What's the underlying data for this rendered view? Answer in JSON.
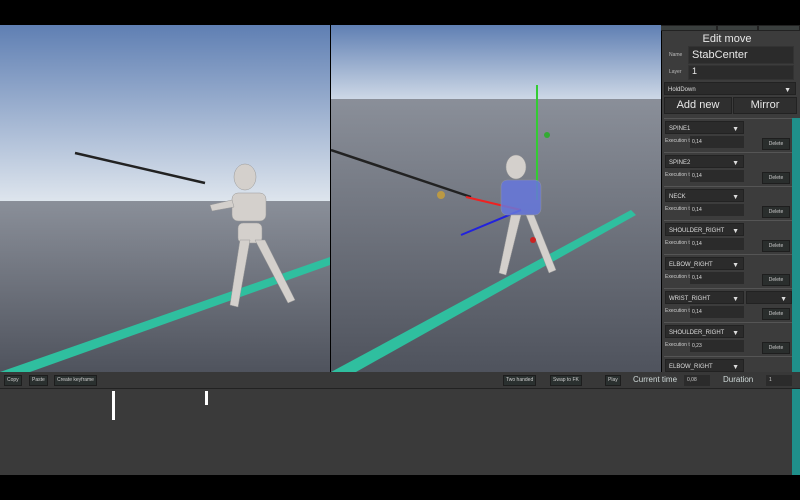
{
  "top_tabs": [
    "",
    "",
    "",
    "",
    ""
  ],
  "edit_panel": {
    "title": "Edit move",
    "name_label": "Name",
    "name_value": "StabCenter",
    "layer_label": "Layer",
    "layer_value": "1",
    "hold_dropdown": "HoldDown",
    "add_new": "Add new",
    "mirror": "Mirror",
    "execution_label": "Execution time",
    "delete_label": "Delete",
    "bones": [
      {
        "bone": "SPINE1",
        "time": "0,14"
      },
      {
        "bone": "SPINE2",
        "time": "0,14"
      },
      {
        "bone": "NECK",
        "time": "0,14"
      },
      {
        "bone": "SHOULDER_RIGHT",
        "time": "0,14"
      },
      {
        "bone": "ELBOW_RIGHT",
        "time": "0,14"
      },
      {
        "bone": "WRIST_RIGHT",
        "time": "0,14",
        "extra_dropdown": ""
      },
      {
        "bone": "SHOULDER_RIGHT",
        "time": "0,23"
      },
      {
        "bone": "ELBOW_RIGHT",
        "time": ""
      }
    ]
  },
  "toolbar": {
    "copy": "Copy",
    "paste": "Paste",
    "create_keyframe": "Create keyframe",
    "two_handed": "Two handed",
    "swap_to_fk": "Swap to FK",
    "play": "Play",
    "current_time_label": "Current time",
    "current_time_value": "0,08",
    "duration_label": "Duration",
    "duration_value": "1"
  },
  "colors": {
    "accent": "#1f8f8a",
    "floor_line": "#2fbf9f",
    "panel": "#3c3c3c"
  }
}
